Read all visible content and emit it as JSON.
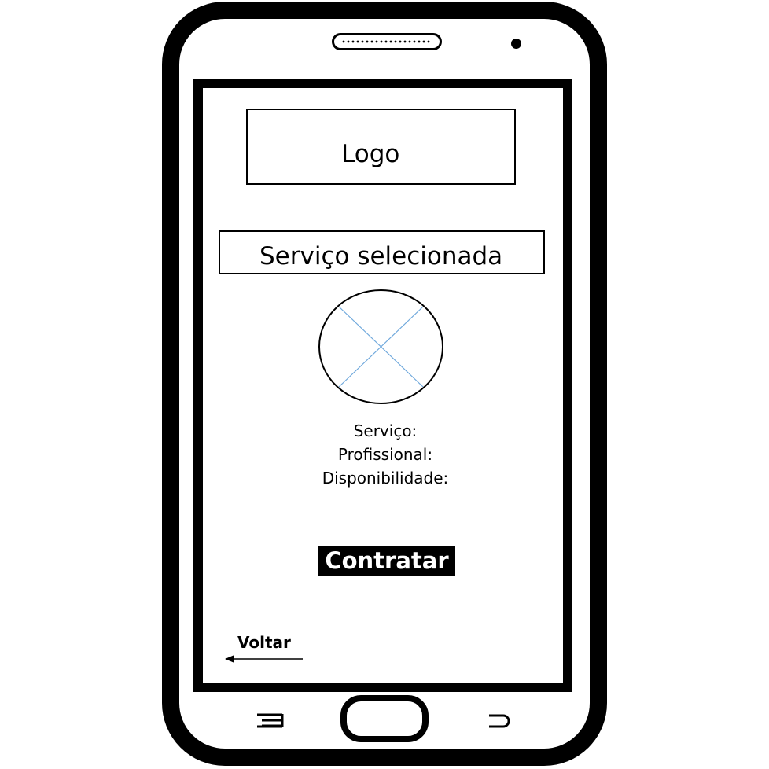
{
  "screen": {
    "logo_label": "Logo",
    "section_title": "Serviço selecionada",
    "details": [
      {
        "label": "Serviço:"
      },
      {
        "label": "Profissional:"
      },
      {
        "label": "Disponibilidade:"
      }
    ],
    "hire_button_label": "Contratar",
    "back_label": "Voltar"
  },
  "icons": {
    "image_placeholder": "image-placeholder-icon",
    "back_arrow": "arrow-left-icon",
    "menu": "menu-icon",
    "home": "home-button",
    "back": "back-icon"
  },
  "colors": {
    "frame": "#000000",
    "screen_background": "#ffffff",
    "placeholder_cross": "#6fa8dc",
    "button_background": "#000000",
    "button_text": "#ffffff"
  }
}
